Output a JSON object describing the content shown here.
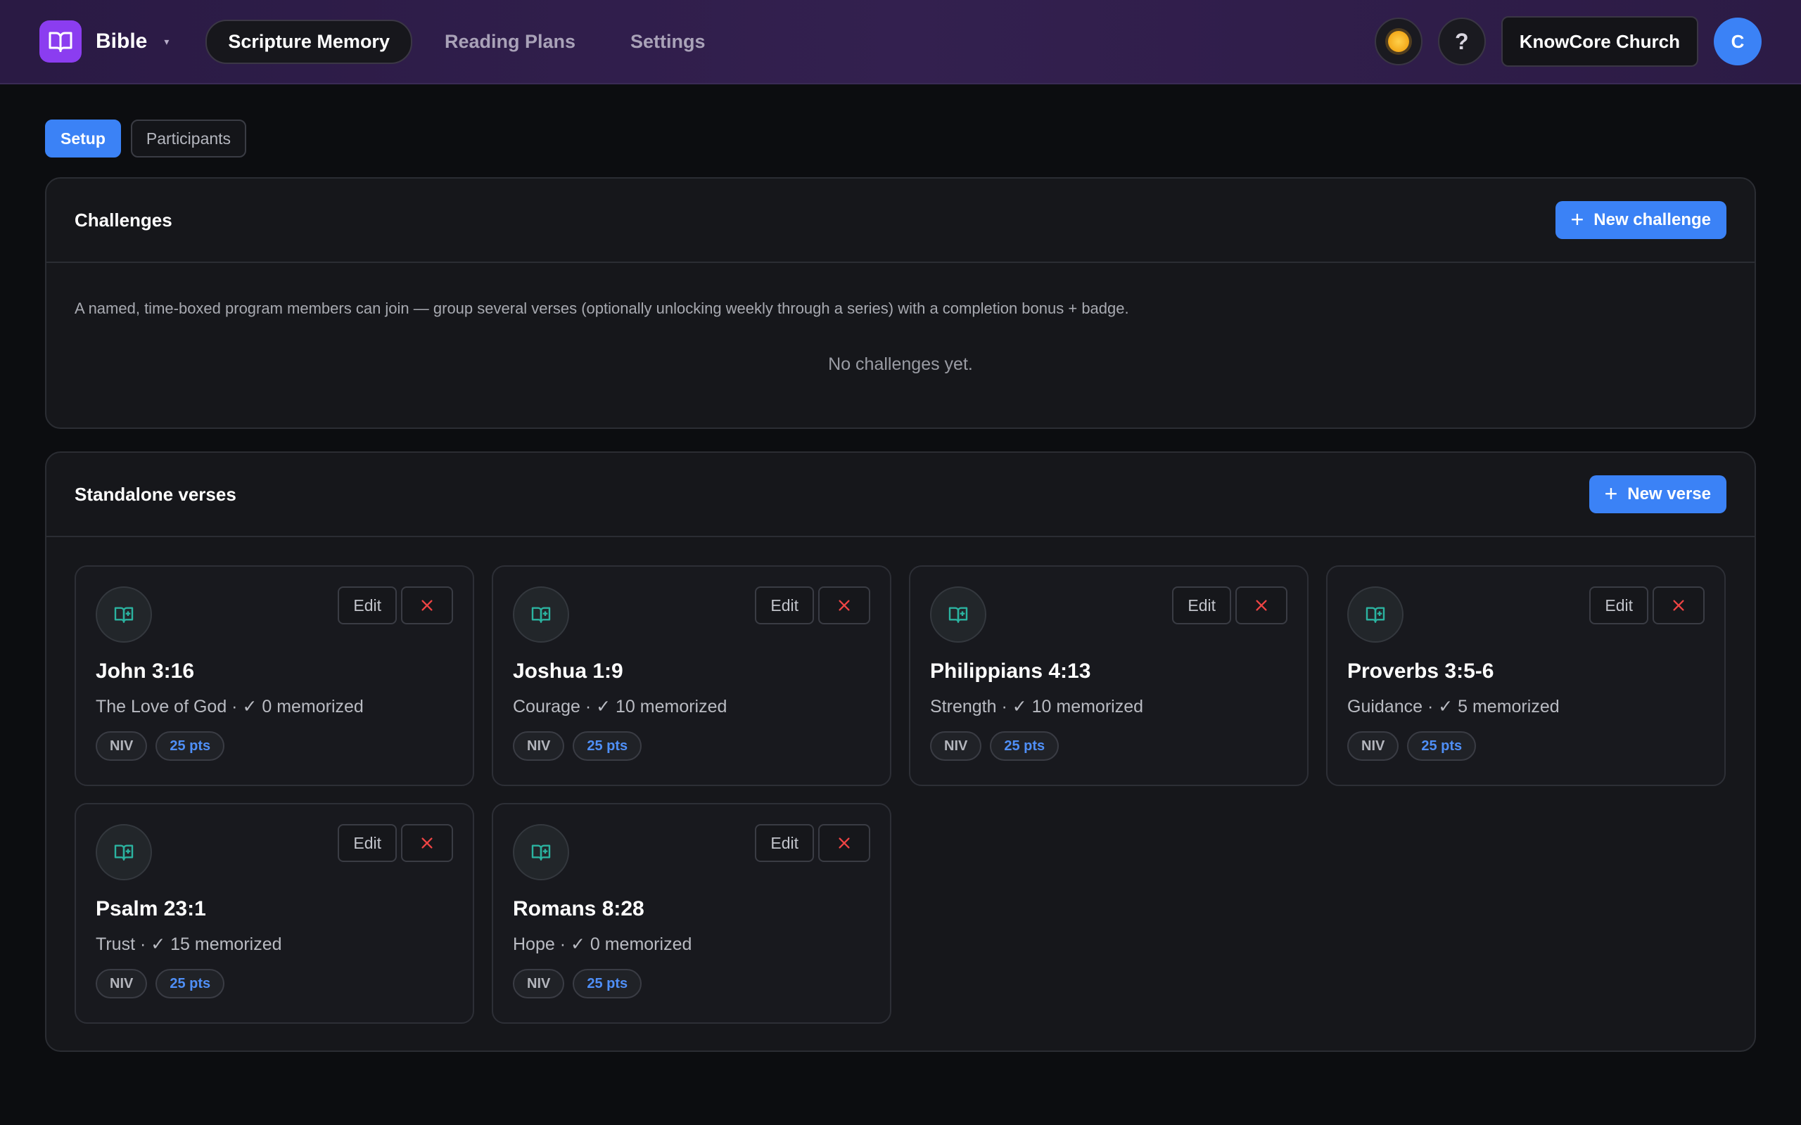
{
  "header": {
    "brand_name": "Bible",
    "brand_caret": "▾",
    "nav": [
      {
        "label": "Scripture Memory",
        "active": true
      },
      {
        "label": "Reading Plans",
        "active": false
      },
      {
        "label": "Settings",
        "active": false
      }
    ],
    "help_label": "?",
    "org_label": "KnowCore Church",
    "avatar_initial": "C"
  },
  "subtabs": [
    {
      "label": "Setup",
      "active": true
    },
    {
      "label": "Participants",
      "active": false
    }
  ],
  "challenges": {
    "title": "Challenges",
    "new_label": "New challenge",
    "description": "A named, time-boxed program members can join — group several verses (optionally unlocking weekly through a series) with a completion bonus + badge.",
    "empty_text": "No challenges yet."
  },
  "verses": {
    "title": "Standalone verses",
    "new_label": "New verse",
    "edit_label": "Edit",
    "items": [
      {
        "ref": "John 3:16",
        "meta": "The Love of God · ✓ 0 memorized",
        "translation": "NIV",
        "points": "25 pts"
      },
      {
        "ref": "Joshua 1:9",
        "meta": "Courage · ✓ 10 memorized",
        "translation": "NIV",
        "points": "25 pts"
      },
      {
        "ref": "Philippians 4:13",
        "meta": "Strength · ✓ 10 memorized",
        "translation": "NIV",
        "points": "25 pts"
      },
      {
        "ref": "Proverbs 3:5-6",
        "meta": "Guidance · ✓ 5 memorized",
        "translation": "NIV",
        "points": "25 pts"
      },
      {
        "ref": "Psalm 23:1",
        "meta": "Trust · ✓ 15 memorized",
        "translation": "NIV",
        "points": "25 pts"
      },
      {
        "ref": "Romans 8:28",
        "meta": "Hope · ✓ 0 memorized",
        "translation": "NIV",
        "points": "25 pts"
      }
    ]
  },
  "colors": {
    "accent": "#3b82f6",
    "brand": "#8b3df0",
    "verse_icon": "#2bb3a0",
    "delete": "#ef4444"
  },
  "icons": {
    "brand": "open-book-icon",
    "theme": "sun-icon",
    "help": "question-icon",
    "verse": "book-plus-icon",
    "delete": "close-icon",
    "add": "plus-icon"
  }
}
